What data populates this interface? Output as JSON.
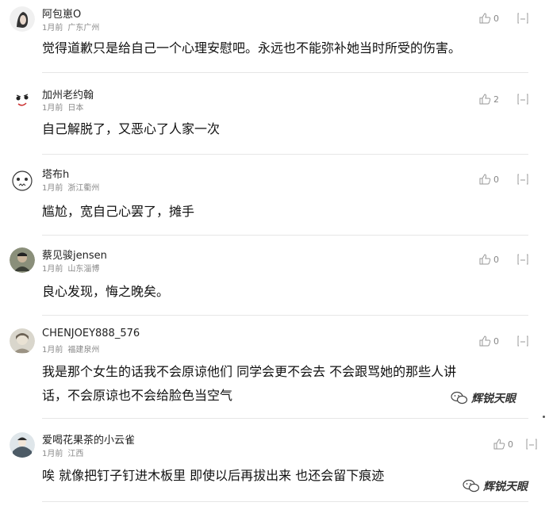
{
  "comments": [
    {
      "username": "阿包崽O",
      "time": "1月前",
      "location": "广东广州",
      "likes": "0",
      "text": "觉得道歉只是给自己一个心理安慰吧。永远也不能弥补她当时所受的伤害。"
    },
    {
      "username": "加州老约翰",
      "time": "1月前",
      "location": "日本",
      "likes": "2",
      "text": "自己解脱了，又恶心了人家一次"
    },
    {
      "username": "塔布h",
      "time": "1月前",
      "location": "浙江衢州",
      "likes": "0",
      "text": "尴尬，宽自己心罢了，摊手"
    },
    {
      "username": "蔡见骏jensen",
      "time": "1月前",
      "location": "山东淄博",
      "likes": "0",
      "text": "良心发现，悔之晚矣。"
    },
    {
      "username": "CHENJOEY888_576",
      "time": "1月前",
      "location": "福建泉州",
      "likes": "0",
      "text_line1": "我是那个女生的话我不会原谅他们 同学会更不会去 不会跟骂她的那些人讲",
      "text_line2": "话，不会原谅也不会给脸色当空气"
    },
    {
      "username": "爱喝花果茶的小云雀",
      "time": "1月前",
      "location": "江西",
      "likes": "0",
      "text": "唉 就像把钉子钉进木板里 即使以后再拔出来 也还会留下痕迹"
    }
  ],
  "watermark": "辉锐天眼",
  "icons": {
    "like": "thumbs-up-icon",
    "reply": "reply-icon"
  }
}
